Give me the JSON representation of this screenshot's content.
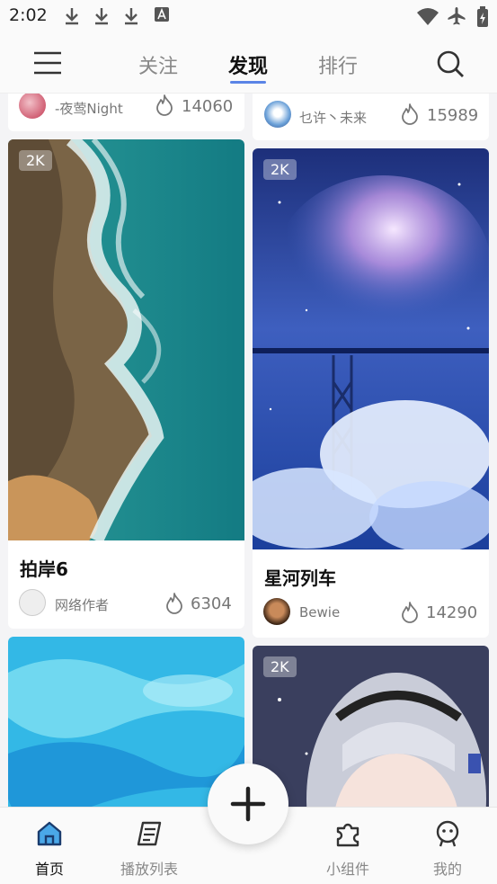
{
  "status_bar": {
    "time": "2:02"
  },
  "top_nav": {
    "tabs": [
      {
        "label": "关注"
      },
      {
        "label": "发现"
      },
      {
        "label": "排行"
      }
    ]
  },
  "feed": {
    "top_left_partial": {
      "author": "-夜莺Night",
      "likes": "14060"
    },
    "top_right_partial": {
      "author": "乜许丶未来",
      "likes": "15989"
    },
    "cards": [
      {
        "badge": "2K",
        "title": "拍岸6",
        "author": "网络作者",
        "likes": "6304"
      },
      {
        "badge": "2K",
        "title": "星河列车",
        "author": "Bewie",
        "likes": "14290"
      },
      {
        "badge": ""
      },
      {
        "badge": "2K"
      }
    ]
  },
  "bottom_nav": {
    "items": [
      {
        "label": "首页"
      },
      {
        "label": "播放列表"
      },
      {
        "label": "小组件"
      },
      {
        "label": "我的"
      }
    ]
  },
  "colors": {
    "accent": "#5a84e6",
    "active_icon": "#4aa8e8"
  }
}
